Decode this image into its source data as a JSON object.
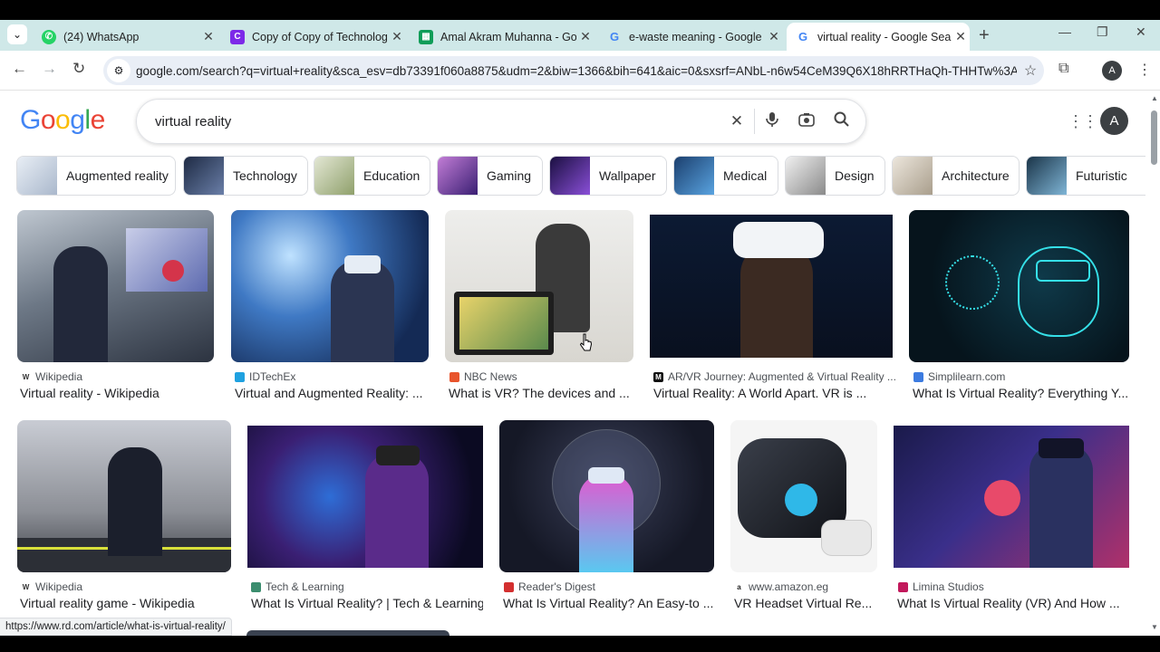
{
  "browser": {
    "tabs": [
      {
        "title": "(24) WhatsApp",
        "icon": "whatsapp-icon",
        "color": "#25d366"
      },
      {
        "title": "Copy of Copy of Technology",
        "icon": "canva-icon",
        "color": "#7d2ae8"
      },
      {
        "title": "Amal Akram Muhanna - Goo",
        "icon": "sheets-icon",
        "color": "#0f9d58"
      },
      {
        "title": "e-waste meaning - Google S",
        "icon": "google-icon",
        "color": "#4285f4"
      },
      {
        "title": "virtual reality - Google Searc",
        "icon": "google-icon",
        "color": "#4285f4"
      }
    ],
    "url": "google.com/search?q=virtual+reality&sca_esv=db73391f060a8875&udm=2&biw=1366&bih=641&aic=0&sxsrf=ANbL-n6w54CeM39Q6X18hRRTHaQh-THHTw%3A...",
    "profile_initial": "A"
  },
  "google": {
    "logo": "Google",
    "query": "virtual reality",
    "avatar_initial": "A"
  },
  "chips": [
    {
      "label": "Augmented reality",
      "color": "#cdd9e5"
    },
    {
      "label": "Technology",
      "color": "#3b4a6b"
    },
    {
      "label": "Education",
      "color": "#b9c7a3"
    },
    {
      "label": "Gaming",
      "color": "#6a3fa0"
    },
    {
      "label": "Wallpaper",
      "color": "#2a1a5e"
    },
    {
      "label": "Medical",
      "color": "#2e6fae"
    },
    {
      "label": "Design",
      "color": "#c9c9c9"
    },
    {
      "label": "Architecture",
      "color": "#d8d2c8"
    },
    {
      "label": "Futuristic",
      "color": "#3f6d8c"
    }
  ],
  "results": [
    {
      "source": "Wikipedia",
      "caption": "Virtual reality - Wikipedia",
      "icon": "W",
      "icon_color": "#333333"
    },
    {
      "source": "IDTechEx",
      "caption": "Virtual and Augmented Reality: ...",
      "icon": "",
      "icon_color": "#1fa1e0"
    },
    {
      "source": "NBC News",
      "caption": "What is VR? The devices and ...",
      "icon": "",
      "icon_color": "#e8542c"
    },
    {
      "source": "AR/VR Journey: Augmented & Virtual Reality ...",
      "caption": "Virtual Reality: A World Apart. VR is ...",
      "icon": "M",
      "icon_color": "#111111"
    },
    {
      "source": "Simplilearn.com",
      "caption": "What Is Virtual Reality? Everything Y...",
      "icon": "",
      "icon_color": "#3c7be0"
    },
    {
      "source": "Wikipedia",
      "caption": "Virtual reality game - Wikipedia",
      "icon": "W",
      "icon_color": "#333333"
    },
    {
      "source": "Tech & Learning",
      "caption": "What Is Virtual Reality? | Tech & Learning",
      "icon": "",
      "icon_color": "#3b8d6e"
    },
    {
      "source": "Reader's Digest",
      "caption": "What Is Virtual Reality? An Easy-to ...",
      "icon": "",
      "icon_color": "#d32f2f"
    },
    {
      "source": "www.amazon.eg",
      "caption": "VR Headset Virtual Re...",
      "icon": "a",
      "icon_color": "#222222"
    },
    {
      "source": "Limina Studios",
      "caption": "What Is Virtual Reality (VR) And How ...",
      "icon": "",
      "icon_color": "#c2185b"
    }
  ],
  "status_url": "https://www.rd.com/article/what-is-virtual-reality/"
}
